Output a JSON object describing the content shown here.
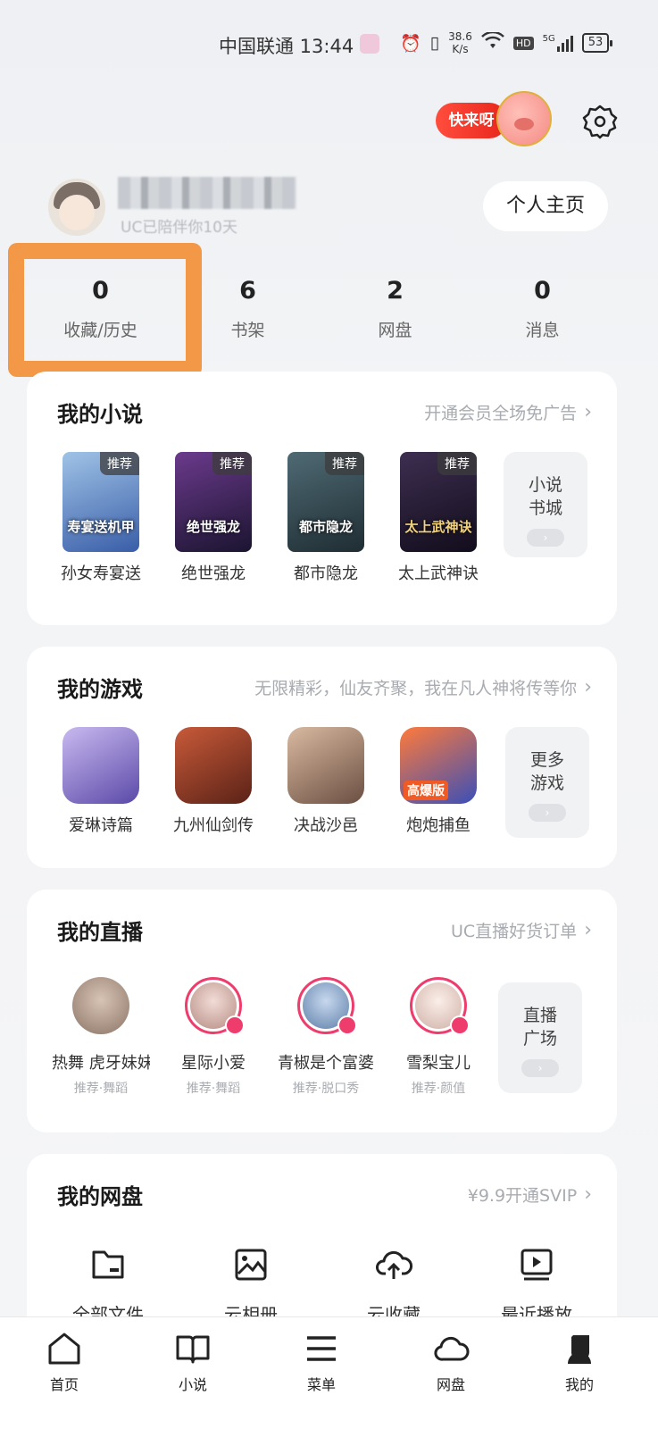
{
  "status_bar": {
    "carrier_time": "中国联通 13:44",
    "speed_top": "38.6",
    "speed_unit": "K/s",
    "hd": "HD",
    "network": "5G",
    "battery": "53"
  },
  "header": {
    "promo_label": "快来呀",
    "settings_icon": "gear-icon"
  },
  "profile": {
    "button_label": "个人主页",
    "subline": "UC已陪伴你10天"
  },
  "stats": [
    {
      "value": "0",
      "label": "收藏/历史"
    },
    {
      "value": "6",
      "label": "书架"
    },
    {
      "value": "2",
      "label": "网盘"
    },
    {
      "value": "0",
      "label": "消息"
    }
  ],
  "novels": {
    "title": "我的小说",
    "link": "开通会员全场免广告",
    "items": [
      {
        "label": "孙女寿宴送",
        "tag": "推荐",
        "cover_text": "寿宴送机甲",
        "color1": "#9fc3e6",
        "color2": "#3a5ea8"
      },
      {
        "label": "绝世强龙",
        "tag": "推荐",
        "cover_text": "绝世强龙",
        "color1": "#6b3a8c",
        "color2": "#1b1430"
      },
      {
        "label": "都市隐龙",
        "tag": "推荐",
        "cover_text": "都市隐龙",
        "color1": "#4f6a74",
        "color2": "#1f2d33"
      },
      {
        "label": "太上武神诀",
        "tag": "推荐",
        "cover_text": "太上武神诀",
        "color1": "#3d2e50",
        "color2": "#120d1c"
      }
    ],
    "more": {
      "line1": "小说",
      "line2": "书城",
      "btn": "›"
    }
  },
  "games": {
    "title": "我的游戏",
    "link": "无限精彩，仙友齐聚，我在凡人神将传等你",
    "items": [
      {
        "label": "爱琳诗篇",
        "color1": "#c9b9f0",
        "color2": "#5b4aa8"
      },
      {
        "label": "九州仙剑传",
        "color1": "#c85a3a",
        "color2": "#5a2216"
      },
      {
        "label": "决战沙邑",
        "color1": "#d9b9a0",
        "color2": "#6b4f42"
      },
      {
        "label": "炮炮捕鱼",
        "color1": "#ff7a3a",
        "color2": "#3a4fb8",
        "badge": "高爆版"
      }
    ],
    "more": {
      "line1": "更多",
      "line2": "游戏",
      "btn": "›"
    }
  },
  "live": {
    "title": "我的直播",
    "link": "UC直播好货订单",
    "items": [
      {
        "label": "热舞 虎牙妹妹",
        "sub": "推荐·舞蹈",
        "color": "#a38c7c",
        "ring": false
      },
      {
        "label": "星际小爱",
        "sub": "推荐·舞蹈",
        "color": "#e9c9c2",
        "ring": true
      },
      {
        "label": "青椒是个富婆",
        "sub": "推荐·脱口秀",
        "color": "#8fb0d8",
        "ring": true
      },
      {
        "label": "雪梨宝儿",
        "sub": "推荐·颜值",
        "color": "#f0dcd6",
        "ring": true
      }
    ],
    "more": {
      "line1": "直播",
      "line2": "广场",
      "btn": "›"
    }
  },
  "disk": {
    "title": "我的网盘",
    "link": "¥9.9开通SVIP",
    "items": [
      {
        "label": "全部文件",
        "icon": "folder-icon"
      },
      {
        "label": "云相册",
        "icon": "image-icon"
      },
      {
        "label": "云收藏",
        "icon": "cloud-upload-icon"
      },
      {
        "label": "最近播放",
        "icon": "video-icon"
      }
    ]
  },
  "bottom_nav": [
    {
      "label": "首页",
      "icon": "home-icon"
    },
    {
      "label": "小说",
      "icon": "book-icon"
    },
    {
      "label": "菜单",
      "icon": "menu-icon"
    },
    {
      "label": "网盘",
      "icon": "cloud-icon"
    },
    {
      "label": "我的",
      "icon": "user-icon"
    }
  ],
  "colors": {
    "accent": "#ee3d6d",
    "highlight": "#f29847"
  }
}
